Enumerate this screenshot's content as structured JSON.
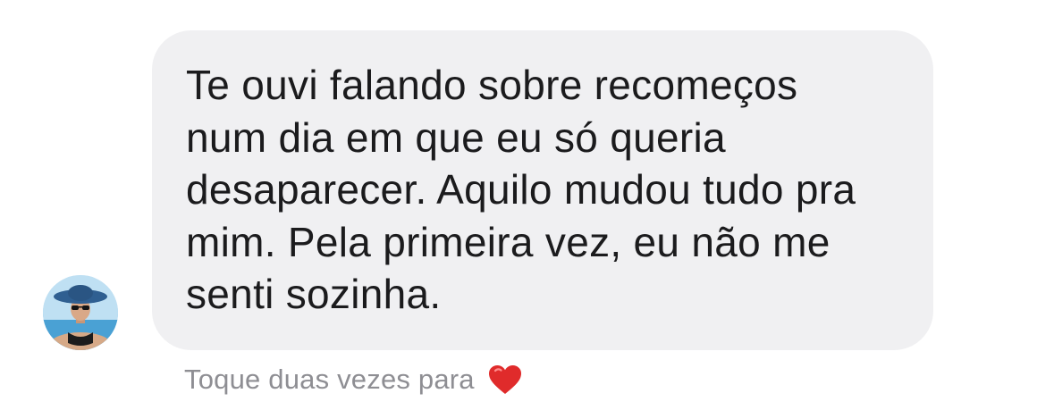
{
  "message": {
    "sender_avatar": "avatar-woman-sun-hat-icon",
    "bubble_color": "#f0f0f2",
    "text": "Te ouvi falando sobre recomeços\nnum dia em que eu só queria\ndesaparecer. Aquilo mudou tudo pra\nmim. Pela primeira vez, eu não me\nsenti sozinha."
  },
  "reaction_hint": {
    "label": "Toque duas vezes para",
    "icon": "red-heart-icon",
    "heart_color": "#e02b2b"
  }
}
